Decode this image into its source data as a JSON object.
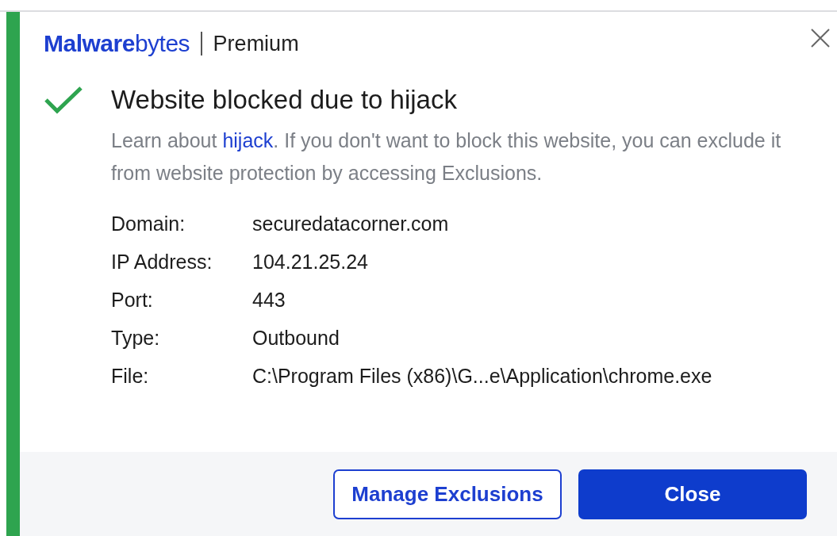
{
  "header": {
    "logo": "**Malware**bytes",
    "edition": "Premium"
  },
  "status": {
    "kind": "blocked",
    "title": "Website blocked due to hijack"
  },
  "description": {
    "before": "Learn about ",
    "link": "hijack",
    "after": ". If you don't want to block this website, you can exclude it from website protection by accessing Exclusions."
  },
  "details": [
    {
      "label": "Domain:",
      "value": "securedatacorner.com"
    },
    {
      "label": "IP Address:",
      "value": "104.21.25.24"
    },
    {
      "label": "Port:",
      "value": "443"
    },
    {
      "label": "Type:",
      "value": "Outbound"
    },
    {
      "label": "File:",
      "value": "C:\\Program Files (x86)\\G...e\\Application\\chrome.exe"
    }
  ],
  "buttons": [
    {
      "label": "Manage Exclusions",
      "kind": "secondary"
    },
    {
      "label": "Close",
      "kind": "primary"
    }
  ]
}
